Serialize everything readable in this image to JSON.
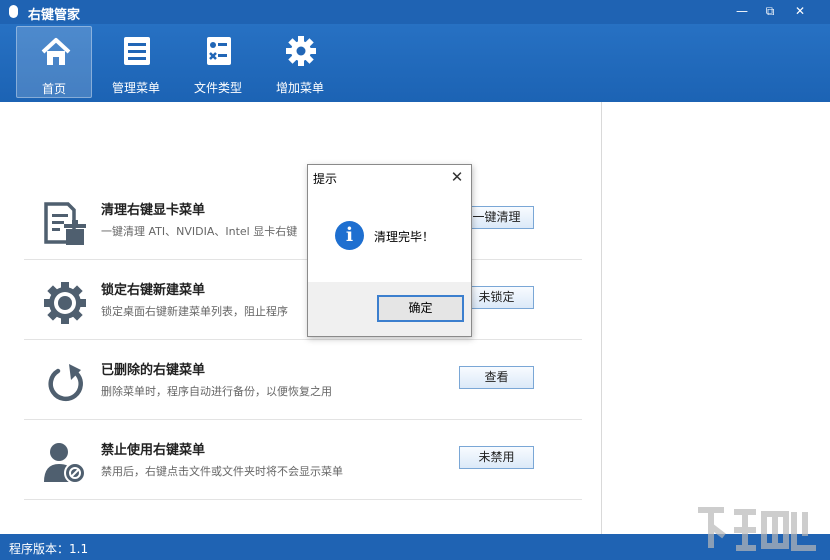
{
  "window": {
    "title": "右键管家",
    "controls": {
      "minimize": "—",
      "restore": "⧉",
      "close": "✕"
    }
  },
  "toolbar": {
    "tabs": [
      {
        "label": "首页",
        "icon": "home-icon"
      },
      {
        "label": "管理菜单",
        "icon": "list-icon"
      },
      {
        "label": "文件类型",
        "icon": "file-type-icon"
      },
      {
        "label": "增加菜单",
        "icon": "gear-icon"
      }
    ],
    "active": "首页"
  },
  "items": [
    {
      "title": "清理右键显卡菜单",
      "desc": "一键清理 ATI、NVIDIA、Intel 显卡右键",
      "button": "一键清理",
      "icon": "clean-icon"
    },
    {
      "title": "锁定右键新建菜单",
      "desc": "锁定桌面右键新建菜单列表，阻止程序",
      "button": "未锁定",
      "icon": "gear-icon"
    },
    {
      "title": "已删除的右键菜单",
      "desc": "删除菜单时，程序自动进行备份，以便恢复之用",
      "button": "查看",
      "icon": "restore-icon"
    },
    {
      "title": "禁止使用右键菜单",
      "desc": "禁用后，右键点击文件或文件夹时将不会显示菜单",
      "button": "未禁用",
      "icon": "user-block-icon"
    }
  ],
  "status": {
    "version": "程序版本：1.1"
  },
  "dialog": {
    "title": "提示",
    "close": "✕",
    "message": "清理完毕！",
    "ok": "确定",
    "icon": "info-icon",
    "info_glyph": "i"
  },
  "colors": {
    "brand": "#1f63b3",
    "icon_gray": "#4f5f6f",
    "dialog_button_border": "#3c7fce"
  }
}
